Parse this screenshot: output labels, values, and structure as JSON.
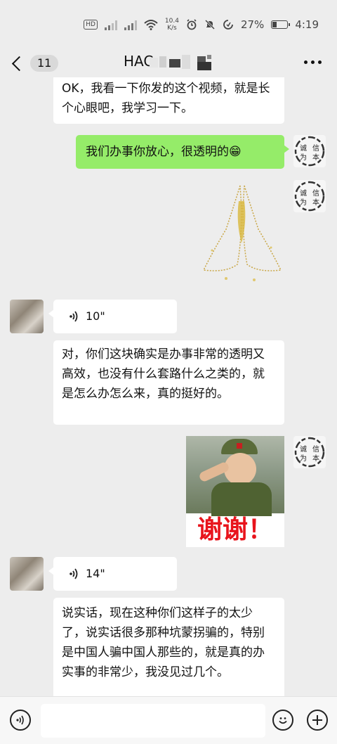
{
  "status_bar": {
    "hd_label": "HD",
    "net_speed_value": "10.4",
    "net_speed_unit": "K/s",
    "battery_percent": "27%",
    "time": "4:19"
  },
  "nav": {
    "unread_count": "11",
    "title_visible": "HAC"
  },
  "messages": [
    {
      "id": "m1",
      "side": "in",
      "type": "text",
      "text": "OK，我看一下你发的这个视频，就是长个心眼吧，我学习一下。"
    },
    {
      "id": "m2",
      "side": "out",
      "type": "text",
      "text": "我们办事你放心，很透明的😁"
    },
    {
      "id": "m3",
      "side": "out",
      "type": "sticker",
      "sticker": "praying-hands-sticker"
    },
    {
      "id": "m4",
      "side": "in",
      "type": "voice",
      "duration": "10\""
    },
    {
      "id": "m5",
      "side": "in",
      "type": "text",
      "text": "对，你们这块确实是办事非常的透明又高效，也没有什么套路什么之类的，就是怎么办怎么来，真的挺好的。"
    },
    {
      "id": "m6",
      "side": "out",
      "type": "sticker",
      "sticker": "salute-thanks-sticker",
      "caption": "谢谢！"
    },
    {
      "id": "m7",
      "side": "in",
      "type": "voice",
      "duration": "14\""
    },
    {
      "id": "m8",
      "side": "in",
      "type": "text",
      "text": "说实话，现在这种你们这样子的太少了，说实话很多那种坑蒙拐骗的，特别是中国人骗中国人那些的，就是真的办实事的非常少，我没见过几个。"
    }
  ],
  "my_avatar": {
    "chars": [
      "诚",
      "信",
      "为",
      "本"
    ]
  },
  "input_bar": {
    "placeholder": ""
  },
  "colors": {
    "bubble_out": "#95ec69",
    "bubble_in": "#ffffff",
    "background": "#ededed",
    "thanks_red": "#e8141c"
  }
}
